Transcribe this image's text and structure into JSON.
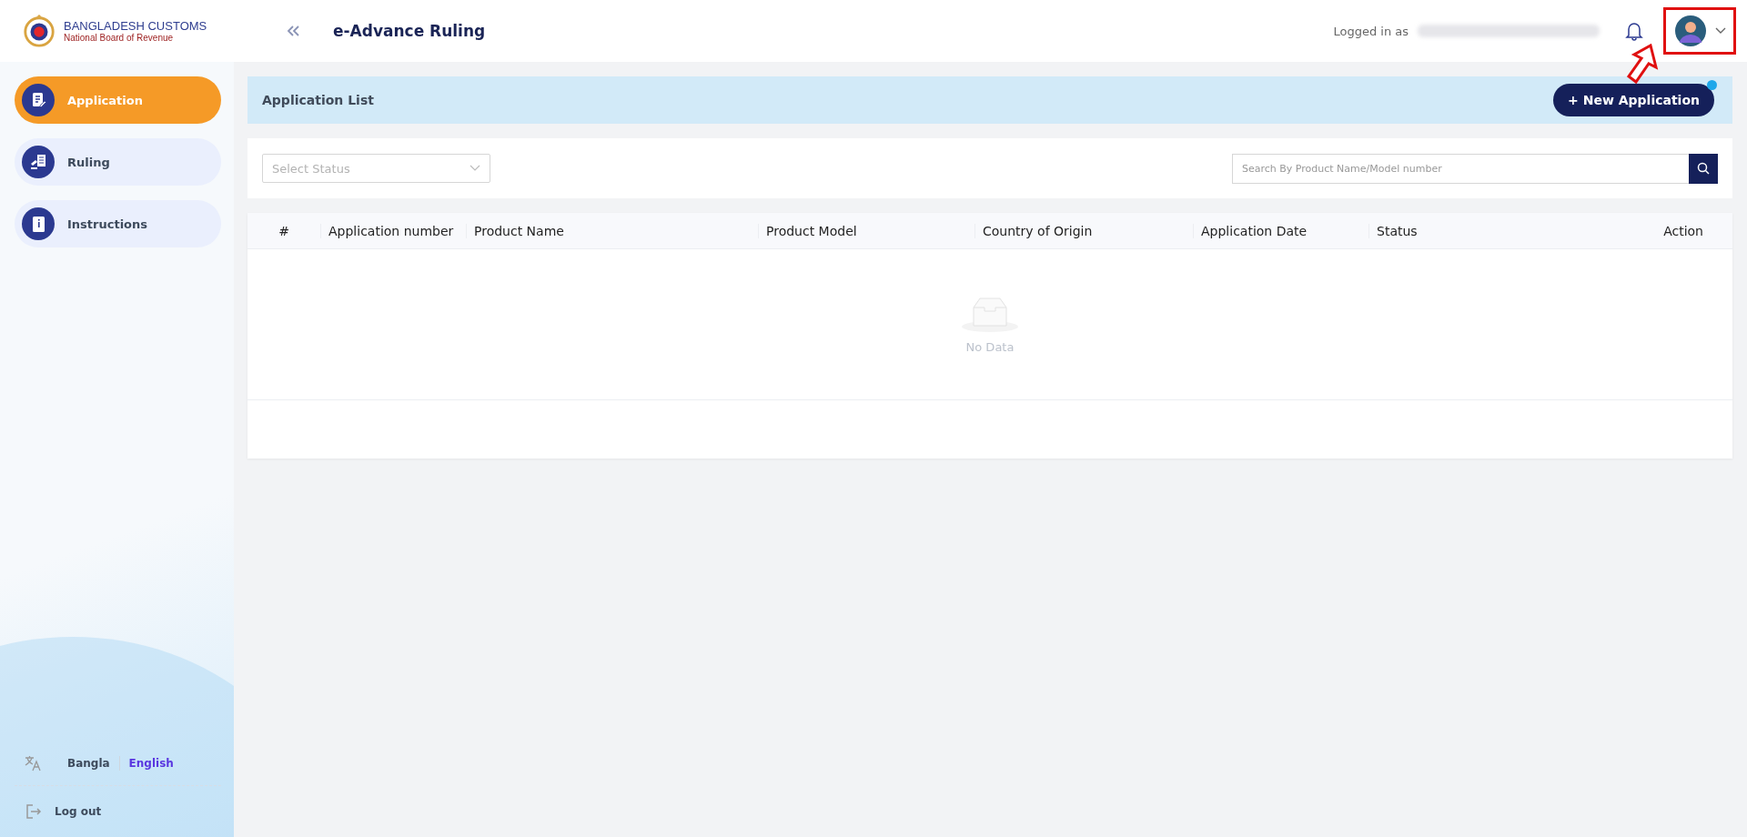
{
  "brand": {
    "name": "BANGLADESH CUSTOMS",
    "subtitle": "National Board of Revenue"
  },
  "header": {
    "title": "e-Advance Ruling",
    "logged_in_label": "Logged in as"
  },
  "sidebar": {
    "items": [
      {
        "label": "Application",
        "kind": "application",
        "selected": true
      },
      {
        "label": "Ruling",
        "kind": "ruling",
        "selected": false
      },
      {
        "label": "Instructions",
        "kind": "instructions",
        "selected": false
      }
    ],
    "languages": [
      {
        "label": "Bangla",
        "selected": false
      },
      {
        "label": "English",
        "selected": true
      }
    ],
    "logout": "Log out"
  },
  "page": {
    "title": "Application List",
    "new_button": "+ New Application"
  },
  "filters": {
    "status_placeholder": "Select Status",
    "search_placeholder": "Search By Product Name/Model number"
  },
  "table": {
    "columns": [
      "#",
      "Application number",
      "Product Name",
      "Product Model",
      "Country of Origin",
      "Application Date",
      "Status",
      "Action"
    ],
    "empty_text": "No Data"
  }
}
